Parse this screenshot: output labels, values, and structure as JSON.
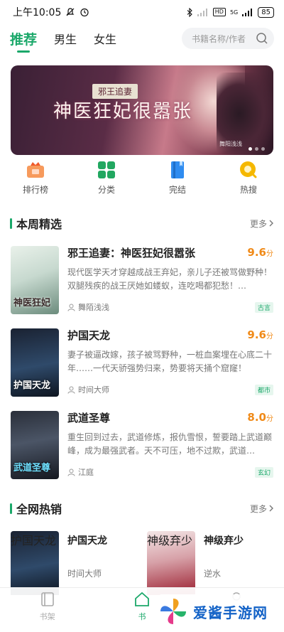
{
  "status_bar": {
    "time": "上午10:05",
    "network": "5G",
    "battery": "85"
  },
  "tabs": [
    {
      "label": "推荐",
      "active": true
    },
    {
      "label": "男生",
      "active": false
    },
    {
      "label": "女生",
      "active": false
    }
  ],
  "search": {
    "placeholder": "书籍名称/作者"
  },
  "banner": {
    "subtitle": "邪王追妻",
    "title": "神医狂妃很嚣张",
    "credit": "舞阳浅浅"
  },
  "quick_entries": [
    {
      "label": "排行榜",
      "icon": "ranking-icon",
      "color": "#f26b3a"
    },
    {
      "label": "分类",
      "icon": "category-icon",
      "color": "#21a760"
    },
    {
      "label": "完结",
      "icon": "completed-book-icon",
      "color": "#2f8cf0"
    },
    {
      "label": "热搜",
      "icon": "hot-search-icon",
      "color": "#f5b800"
    }
  ],
  "weekly": {
    "title": "本周精选",
    "more": "更多",
    "books": [
      {
        "title": "邪王追妻：神医狂妃很嚣张",
        "score": "9.6",
        "score_unit": "分",
        "desc": "现代医学天才穿越成战王弃妃，亲儿子还被骂做野种！双腿残疾的战王厌她如蝼蚁，连吃喝都犯愁！…",
        "author": "舞陌浅浅",
        "tag": "古言",
        "cover_text": "神医狂妃"
      },
      {
        "title": "护国天龙",
        "score": "9.6",
        "score_unit": "分",
        "desc": "妻子被逼改嫁，孩子被骂野种，一桩血案埋在心底二十年……一代天骄强势归来，势要将天捅个窟窿！",
        "author": "时间大师",
        "tag": "都市",
        "cover_text": "护国天龙"
      },
      {
        "title": "武道圣尊",
        "score": "8.0",
        "score_unit": "分",
        "desc": "重生回到过去，武道修炼，报仇雪恨，誓要踏上武道巅峰，成为最强武者。天不可压，地不过欺，武道…",
        "author": "江庭",
        "tag": "玄幻",
        "cover_text": "武道圣尊"
      }
    ]
  },
  "hot": {
    "title": "全网热销",
    "more": "更多",
    "books": [
      {
        "title": "护国天龙",
        "author": "时间大师",
        "cover_text": "护国天龙"
      },
      {
        "title": "神级弃少",
        "author": "逆水",
        "cover_text": "神级弃少"
      }
    ]
  },
  "bottom_nav": [
    {
      "label": "书架",
      "active": false
    },
    {
      "label": "书",
      "active": true
    },
    {
      "label": "",
      "active": false
    }
  ],
  "watermark": {
    "text": "爱酱手游网"
  },
  "colors": {
    "accent": "#1ba86a",
    "score": "#f08a18"
  }
}
